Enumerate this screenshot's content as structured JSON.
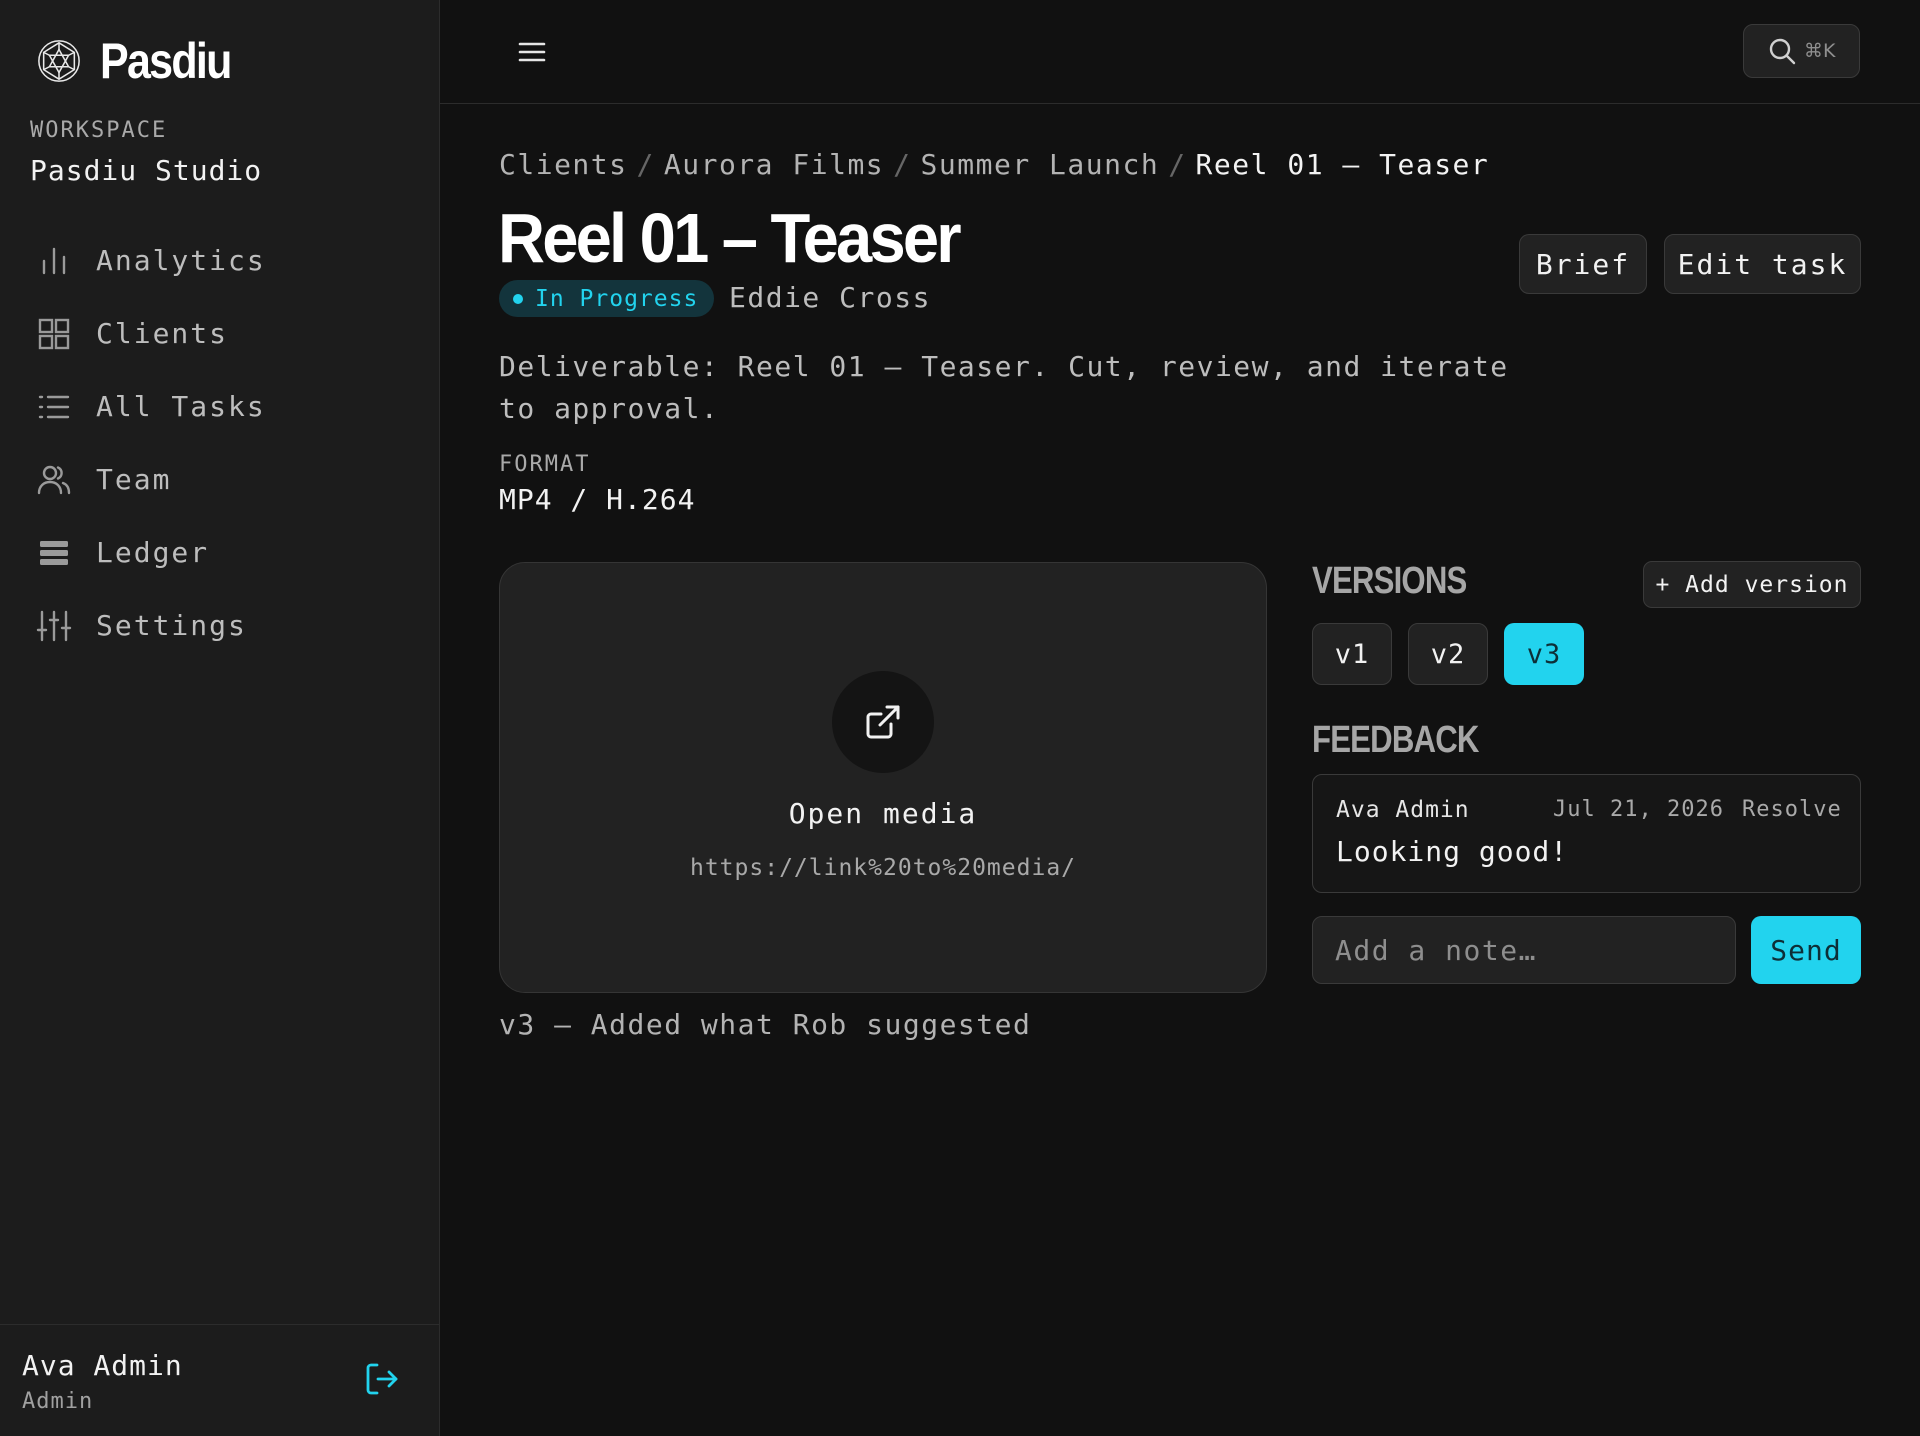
{
  "sidebar": {
    "logo_icon": "geodesic-sphere-icon",
    "brand": "Pasdiu",
    "workspace_label": "WORKSPACE",
    "workspace_name": "Pasdiu Studio",
    "items": [
      {
        "label": "Analytics",
        "icon": "bar-chart-icon"
      },
      {
        "label": "Clients",
        "icon": "grid-icon"
      },
      {
        "label": "All Tasks",
        "icon": "list-icon"
      },
      {
        "label": "Team",
        "icon": "users-icon"
      },
      {
        "label": "Ledger",
        "icon": "stack-icon"
      },
      {
        "label": "Settings",
        "icon": "sliders-icon"
      }
    ],
    "user": {
      "name": "Ava Admin",
      "role": "Admin",
      "logout_icon": "logout-icon"
    }
  },
  "topbar": {
    "menu_icon": "hamburger-icon",
    "search_icon": "search-icon",
    "search_shortcut": "⌘K"
  },
  "breadcrumb": [
    "Clients",
    "Aurora Films",
    "Summer Launch",
    "Reel 01 – Teaser"
  ],
  "task": {
    "title": "Reel 01 – Teaser",
    "status": "In Progress",
    "assignee": "Eddie Cross",
    "brief_label": "Brief",
    "edit_label": "Edit task",
    "description": "Deliverable: Reel 01 – Teaser. Cut, review, and iterate to approval.",
    "format_label": "FORMAT",
    "format_value": "MP4 / H.264"
  },
  "media": {
    "icon": "external-link-icon",
    "label": "Open media",
    "url": "https://link%20to%20media/",
    "caption": "v3 — Added what Rob suggested"
  },
  "versions": {
    "title": "VERSIONS",
    "add_label": "+ Add version",
    "items": [
      "v1",
      "v2",
      "v3"
    ],
    "selected": "v3"
  },
  "feedback": {
    "title": "FEEDBACK",
    "comments": [
      {
        "author": "Ava Admin",
        "date": "Jul 21, 2026",
        "action": "Resolve",
        "text": "Looking good!"
      }
    ],
    "input_placeholder": "Add a note…",
    "send_label": "Send"
  },
  "colors": {
    "accent": "#22d3ee",
    "background": "#111111",
    "sidebar": "#1c1c1c",
    "surface": "#222222"
  }
}
